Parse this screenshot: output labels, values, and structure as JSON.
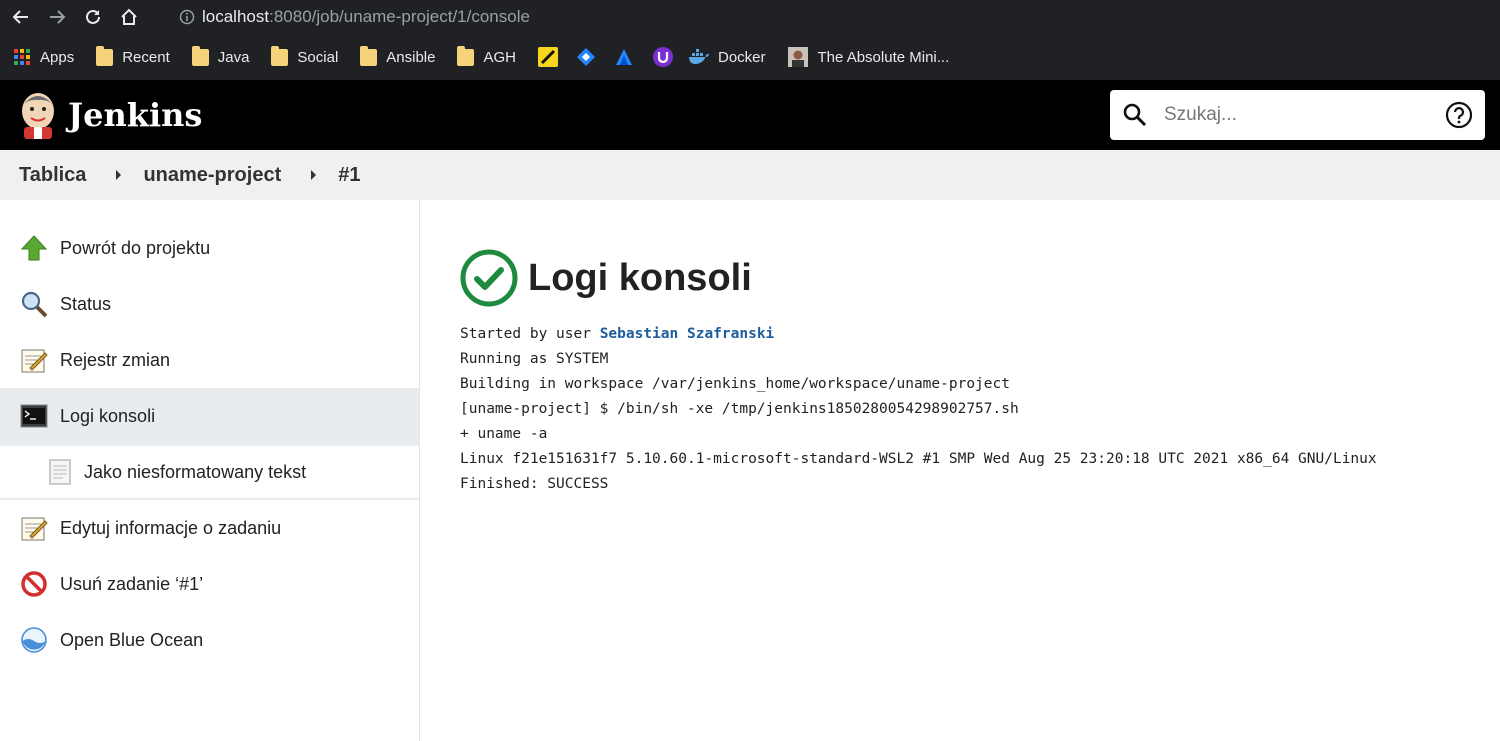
{
  "browser": {
    "url_host": "localhost",
    "url_rest": ":8080/job/uname-project/1/console",
    "bookmarks": [
      {
        "label": "Apps",
        "icon": "apps-grid-icon"
      },
      {
        "label": "Recent",
        "icon": "folder-icon"
      },
      {
        "label": "Java",
        "icon": "folder-icon"
      },
      {
        "label": "Social",
        "icon": "folder-icon"
      },
      {
        "label": "Ansible",
        "icon": "folder-icon"
      },
      {
        "label": "AGH",
        "icon": "folder-icon"
      },
      {
        "label": "Docker",
        "icon": "docker-icon"
      },
      {
        "label": "The Absolute Mini...",
        "icon": "avatar-icon"
      }
    ]
  },
  "header": {
    "title": "Jenkins",
    "search_placeholder": "Szukaj..."
  },
  "breadcrumb": [
    "Tablica",
    "uname-project",
    "#1"
  ],
  "sidebar": {
    "items": [
      {
        "label": "Powrót do projektu",
        "icon": "up-arrow-icon"
      },
      {
        "label": "Status",
        "icon": "magnifier-icon"
      },
      {
        "label": "Rejestr zmian",
        "icon": "notepad-icon"
      },
      {
        "label": "Logi konsoli",
        "icon": "terminal-icon"
      },
      {
        "label": "Jako niesformatowany tekst",
        "icon": "document-icon"
      },
      {
        "label": "Edytuj informacje o zadaniu",
        "icon": "notepad-icon"
      },
      {
        "label": "Usuń zadanie ‘#1’",
        "icon": "no-entry-icon"
      },
      {
        "label": "Open Blue Ocean",
        "icon": "blue-ocean-icon"
      }
    ]
  },
  "main": {
    "title": "Logi konsoli",
    "console": {
      "line1_prefix": "Started by user ",
      "line1_user": "Sebastian Szafranski",
      "lines": [
        "Running as SYSTEM",
        "Building in workspace /var/jenkins_home/workspace/uname-project",
        "[uname-project] $ /bin/sh -xe /tmp/jenkins1850280054298902757.sh",
        "+ uname -a",
        "Linux f21e151631f7 5.10.60.1-microsoft-standard-WSL2 #1 SMP Wed Aug 25 23:20:18 UTC 2021 x86_64 GNU/Linux",
        "Finished: SUCCESS"
      ]
    }
  },
  "colors": {
    "success_green": "#1e8a3e",
    "link_blue": "#1d5d9b",
    "header_black": "#000000"
  }
}
